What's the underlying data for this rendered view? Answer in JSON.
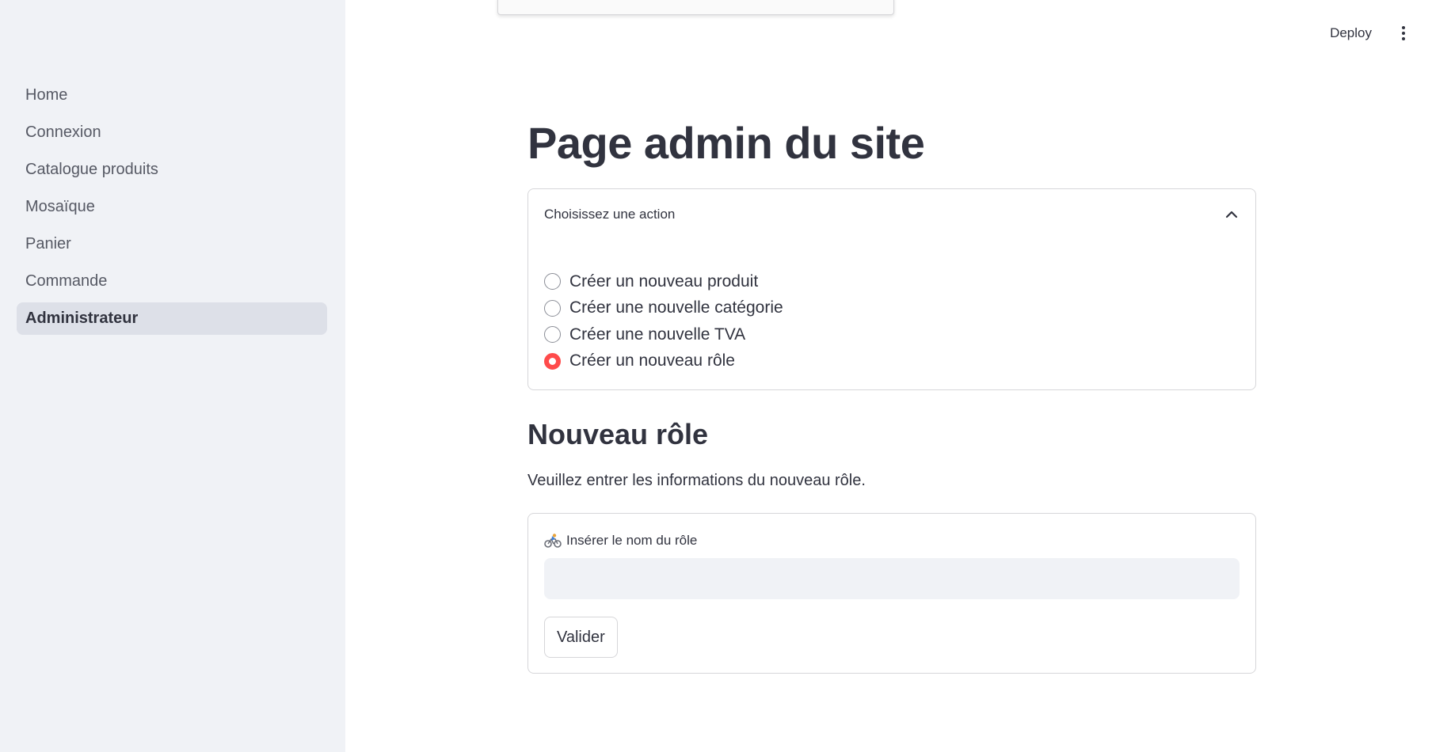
{
  "sidebar": {
    "items": [
      {
        "label": "Home"
      },
      {
        "label": "Connexion"
      },
      {
        "label": "Catalogue produits"
      },
      {
        "label": "Mosaïque"
      },
      {
        "label": "Panier"
      },
      {
        "label": "Commande"
      },
      {
        "label": "Administrateur",
        "active": true
      }
    ]
  },
  "toolbar": {
    "deploy_label": "Deploy",
    "menu_icon": "kebab-menu-icon"
  },
  "main": {
    "title": "Page admin du site",
    "expander": {
      "label": "Choisissez une action",
      "icon": "chevron-up-icon",
      "options": [
        {
          "label": "Créer un nouveau produit",
          "checked": false
        },
        {
          "label": "Créer une nouvelle catégorie",
          "checked": false
        },
        {
          "label": "Créer une nouvelle TVA",
          "checked": false
        },
        {
          "label": "Créer un nouveau rôle",
          "checked": true
        }
      ]
    },
    "section_title": "Nouveau rôle",
    "section_desc": "Veuillez entrer les informations du nouveau rôle.",
    "form": {
      "field_icon": "bicyclist-icon",
      "field_label": "Insérer le nom du rôle",
      "field_value": "",
      "submit_label": "Valider"
    }
  },
  "colors": {
    "accent": "#ff4b4b",
    "sidebar_bg": "#f0f2f6",
    "active_item_bg": "#dde0e8",
    "text": "#31333f",
    "border": "#d6d6d9"
  }
}
